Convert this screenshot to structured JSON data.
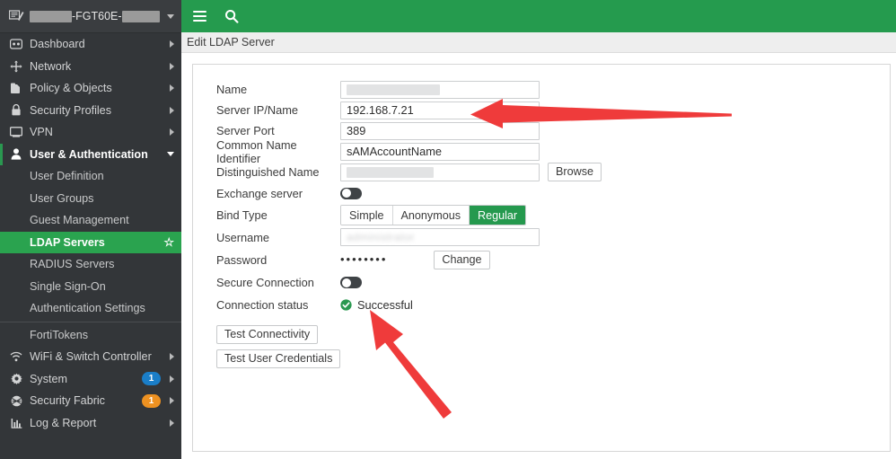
{
  "sidebar": {
    "device": {
      "name_prefix_redacted": true,
      "name_middle": "-FGT60E-",
      "name_suffix_redacted": true,
      "icon": "device-icon",
      "caret": "chevron-down-icon"
    },
    "items": [
      {
        "label": "Dashboard",
        "icon": "dashboard-icon",
        "chevron": "chevron-right-icon",
        "state": "collapsed"
      },
      {
        "label": "Network",
        "icon": "network-icon",
        "chevron": "chevron-right-icon",
        "state": "collapsed"
      },
      {
        "label": "Policy & Objects",
        "icon": "policy-icon",
        "chevron": "chevron-right-icon",
        "state": "collapsed"
      },
      {
        "label": "Security Profiles",
        "icon": "lock-icon",
        "chevron": "chevron-right-icon",
        "state": "collapsed"
      },
      {
        "label": "VPN",
        "icon": "monitor-icon",
        "chevron": "chevron-right-icon",
        "state": "collapsed"
      },
      {
        "label": "User & Authentication",
        "icon": "user-icon",
        "chevron": "chevron-down-icon",
        "state": "expanded"
      }
    ],
    "sub_items": [
      {
        "label": "User Definition",
        "active": false
      },
      {
        "label": "User Groups",
        "active": false
      },
      {
        "label": "Guest Management",
        "active": false
      },
      {
        "label": "LDAP Servers",
        "active": true,
        "star": "☆"
      },
      {
        "label": "RADIUS Servers",
        "active": false
      },
      {
        "label": "Single Sign-On",
        "active": false
      },
      {
        "label": "Authentication Settings",
        "active": false
      }
    ],
    "sub_items_after_divider": [
      {
        "label": "FortiTokens",
        "active": false
      }
    ],
    "items_bottom": [
      {
        "label": "WiFi & Switch Controller",
        "icon": "wifi-icon",
        "chevron": "chevron-right-icon",
        "badge": null
      },
      {
        "label": "System",
        "icon": "gear-icon",
        "chevron": "chevron-right-icon",
        "badge": "1",
        "badge_color": "#1a7ec8"
      },
      {
        "label": "Security Fabric",
        "icon": "fabric-icon",
        "chevron": "chevron-right-icon",
        "badge": "1",
        "badge_color": "#ed9121"
      },
      {
        "label": "Log & Report",
        "icon": "chart-icon",
        "chevron": "chevron-right-icon",
        "badge": null
      }
    ]
  },
  "topbar": {
    "menu_icon": "hamburger-icon",
    "search_icon": "search-icon",
    "background": "#259b4e"
  },
  "breadcrumb": {
    "title": "Edit LDAP Server"
  },
  "form": {
    "rows": {
      "name": {
        "label": "Name",
        "value": "",
        "redacted": true
      },
      "server_ip": {
        "label": "Server IP/Name",
        "value": "192.168.7.21"
      },
      "server_port": {
        "label": "Server Port",
        "value": "389"
      },
      "common_name_identifier": {
        "label": "Common Name Identifier",
        "value": "sAMAccountName"
      },
      "distinguished_name": {
        "label": "Distinguished Name",
        "value": "",
        "redacted": true,
        "button": "Browse"
      },
      "exchange_server": {
        "label": "Exchange server",
        "toggle": "off"
      },
      "bind_type": {
        "label": "Bind Type",
        "options": [
          "Simple",
          "Anonymous",
          "Regular"
        ],
        "selected": "Regular"
      },
      "username": {
        "label": "Username",
        "value": "",
        "blurred": true
      },
      "password": {
        "label": "Password",
        "value": "••••••••",
        "button": "Change"
      },
      "secure_connection": {
        "label": "Secure Connection",
        "toggle": "off"
      },
      "connection_status": {
        "label": "Connection status",
        "value": "Successful",
        "icon": "check-circle-icon",
        "color": "#2a9850"
      }
    },
    "buttons": {
      "test_connectivity": "Test Connectivity",
      "test_user_credentials": "Test User Credentials"
    }
  },
  "annotations": {
    "arrow_color": "#ef3b3b",
    "arrow_1_target": "Server IP/Name field",
    "arrow_2_target": "Connection status Successful"
  }
}
